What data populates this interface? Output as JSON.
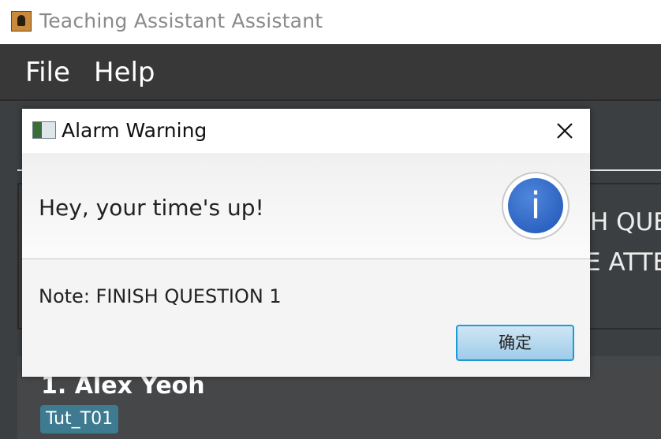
{
  "app": {
    "title": "Teaching Assistant Assistant",
    "icon": "address-book-icon"
  },
  "menu": {
    "items": [
      "File",
      "Help"
    ]
  },
  "background": {
    "result_line1": "H QUE",
    "result_line2": "E ATTE",
    "person": {
      "index_name": "1.  Alex Yeoh",
      "tag": "Tut_T01"
    }
  },
  "dialog": {
    "title": "Alarm Warning",
    "icon": "window-icon",
    "close_icon": "close-icon",
    "header_text": "Hey, your time's up!",
    "info_icon": "information-icon",
    "info_glyph": "i",
    "note": "Note: FINISH QUESTION 1",
    "ok_label": "确定"
  },
  "colors": {
    "app_bg": "#3c3f41",
    "menubar_bg": "#383838",
    "tag_bg": "#3e7b91",
    "ok_border": "#1e9ad6",
    "info_blue": "#2f6bc9"
  }
}
